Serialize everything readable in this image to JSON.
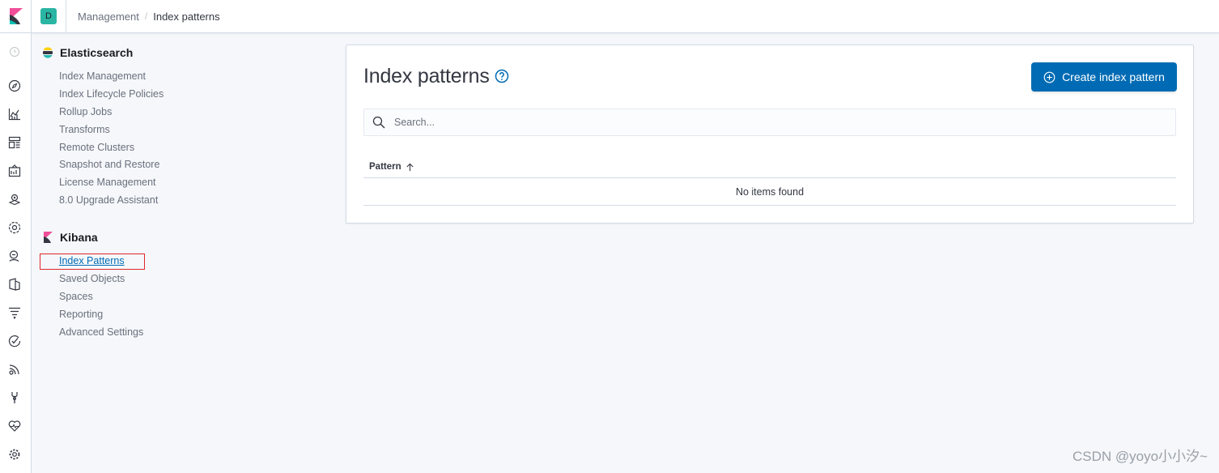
{
  "header": {
    "space_initial": "D",
    "breadcrumbs": [
      "Management",
      "Index patterns"
    ]
  },
  "rail": {
    "icons": [
      "recently-viewed-icon",
      "discover-icon",
      "visualize-icon",
      "dashboard-icon",
      "canvas-icon",
      "maps-icon",
      "machine-learning-icon",
      "metrics-icon",
      "logs-icon",
      "apm-icon",
      "uptime-icon",
      "siem-icon",
      "dev-tools-icon",
      "stack-monitoring-icon",
      "management-icon"
    ]
  },
  "sidenav": {
    "elasticsearch": {
      "title": "Elasticsearch",
      "items": [
        "Index Management",
        "Index Lifecycle Policies",
        "Rollup Jobs",
        "Transforms",
        "Remote Clusters",
        "Snapshot and Restore",
        "License Management",
        "8.0 Upgrade Assistant"
      ]
    },
    "kibana": {
      "title": "Kibana",
      "items": [
        "Index Patterns",
        "Saved Objects",
        "Spaces",
        "Reporting",
        "Advanced Settings"
      ],
      "selected_index": 0
    }
  },
  "main": {
    "title": "Index patterns",
    "create_button": "Create index pattern",
    "search_placeholder": "Search...",
    "table": {
      "column": "Pattern",
      "empty_message": "No items found"
    }
  },
  "watermark": "CSDN @yoyo小小汐~",
  "colors": {
    "primary": "#006bb4",
    "space_avatar": "#2bb5a3",
    "highlight_box": "#e0262c"
  }
}
